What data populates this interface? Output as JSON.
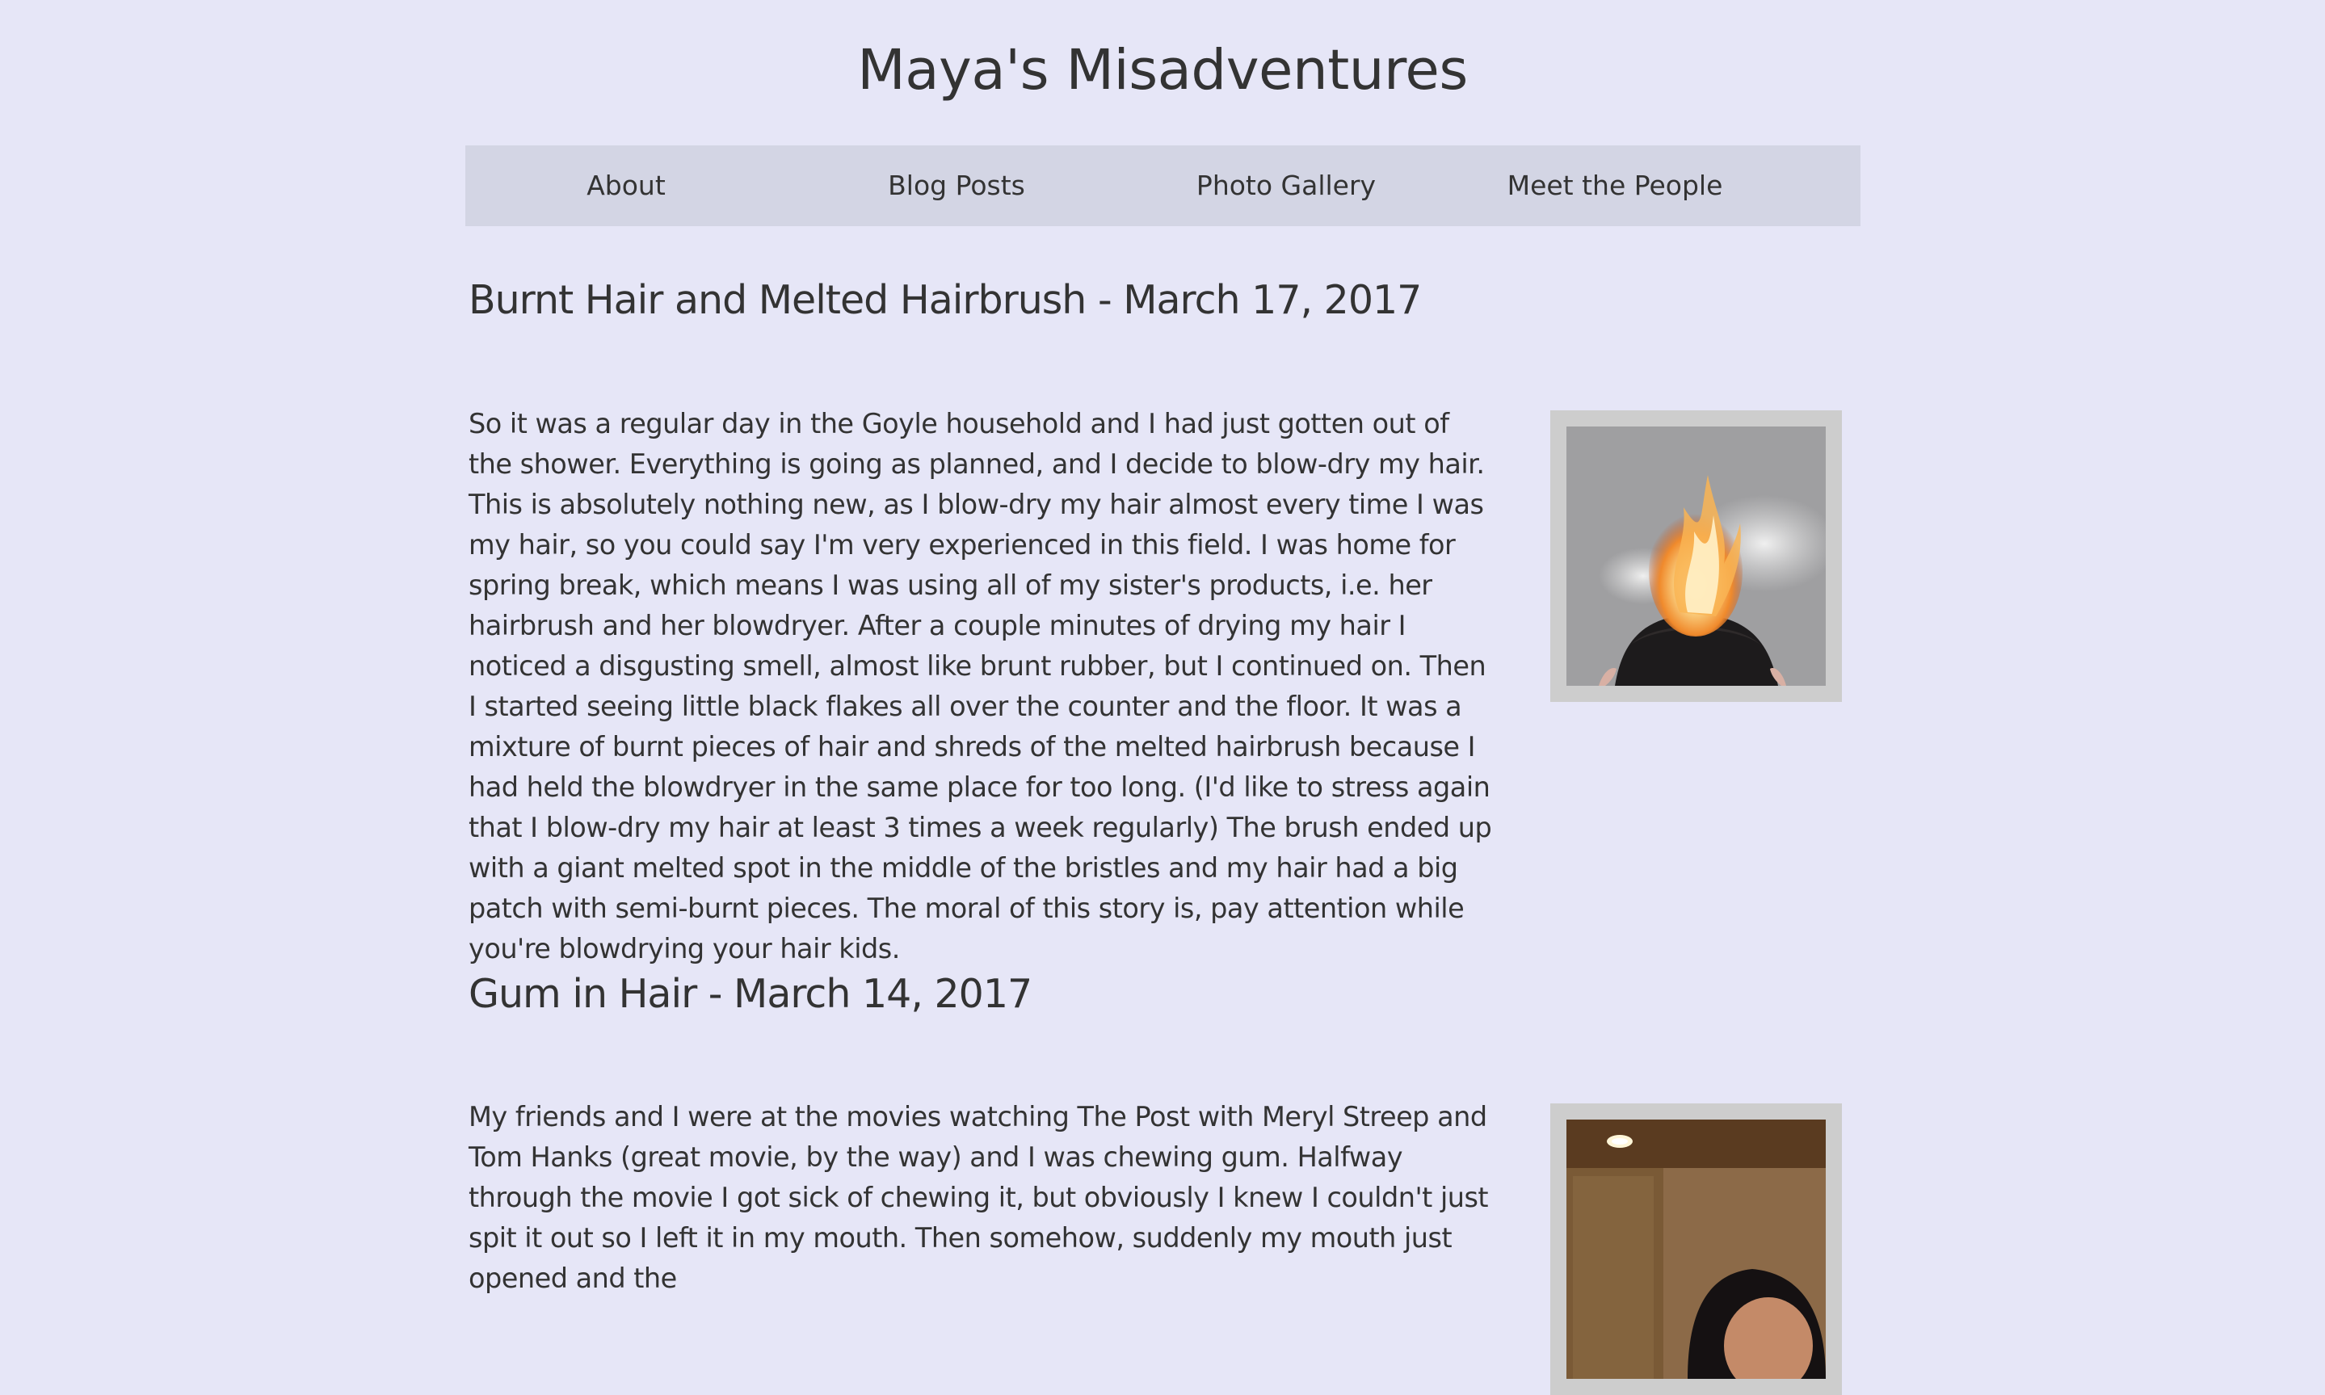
{
  "site": {
    "title": "Maya's Misadventures"
  },
  "nav": {
    "items": [
      {
        "label": "About"
      },
      {
        "label": "Blog Posts"
      },
      {
        "label": "Photo Gallery"
      },
      {
        "label": "Meet the People"
      }
    ]
  },
  "posts": [
    {
      "title": "Burnt Hair and Melted Hairbrush - March 17, 2017",
      "body": "So it was a regular day in the Goyle household and I had just gotten out of the shower. Everything is going as planned, and I decide to blow-dry my hair. This is absolutely nothing new, as I blow-dry my hair almost every time I was my hair, so you could say I'm very experienced in this field. I was home for spring break, which means I was using all of my sister's products, i.e. her hairbrush and her blowdryer. After a couple minutes of drying my hair I noticed a disgusting smell, almost like brunt rubber, but I continued on. Then I started seeing little black flakes all over the counter and the floor. It was a mixture of burnt pieces of hair and shreds of the melted hairbrush because I had held the blowdryer in the same place for too long. (I'd like to stress again that I blow-dry my hair at least 3 times a week regularly) The brush ended up with a giant melted spot in the middle of the bristles and my hair had a big patch with semi-burnt pieces. The moral of this story is, pay attention while you're blowdrying your hair kids."
    },
    {
      "title": "Gum in Hair - March 14, 2017",
      "body": "My friends and I were at the movies watching The Post with Meryl Streep and Tom Hanks (great movie, by the way) and I was chewing gum. Halfway through the movie I got sick of chewing it, but obviously I knew I couldn't just spit it out so I left it in my mouth. Then somehow, suddenly my mouth just opened and the"
    }
  ],
  "colors": {
    "background": "#e6e6f7",
    "nav_background": "#d3d5e4",
    "text": "#333333",
    "photo_frame": "#cdcdcd"
  },
  "icons": {
    "post1_photo": "burning-hair-photo",
    "post2_photo": "selfie-photo"
  }
}
